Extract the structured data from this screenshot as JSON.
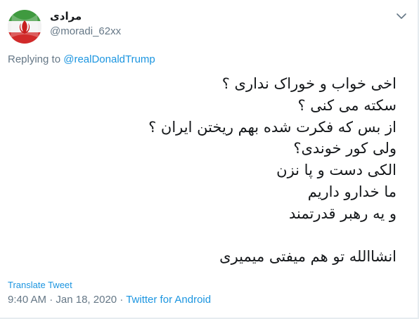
{
  "author": {
    "display_name": "مرادی",
    "handle": "@moradi_62xx"
  },
  "reply": {
    "prefix": "Replying to",
    "target": "@realDonaldTrump"
  },
  "tweet": {
    "text": "اخی خواب و خوراک نداری ؟\nسکته می کنی ؟\nاز بس که فکرت شده بهم ریختن ایران ؟\nولی کور خوندی؟\nالکی دست و پا نزن\nما خدارو داریم\nو یه رهبر قدرتمند\n\nانشاالله تو هم  میفتی میمیری"
  },
  "translate_label": "Translate Tweet",
  "meta": {
    "time": "9:40 AM",
    "sep1": "·",
    "date": "Jan 18, 2020",
    "sep2": "·",
    "source": "Twitter for Android"
  },
  "icons": {
    "menu": "chevron-down-icon",
    "avatar": "iran-flag-emblem-avatar"
  }
}
